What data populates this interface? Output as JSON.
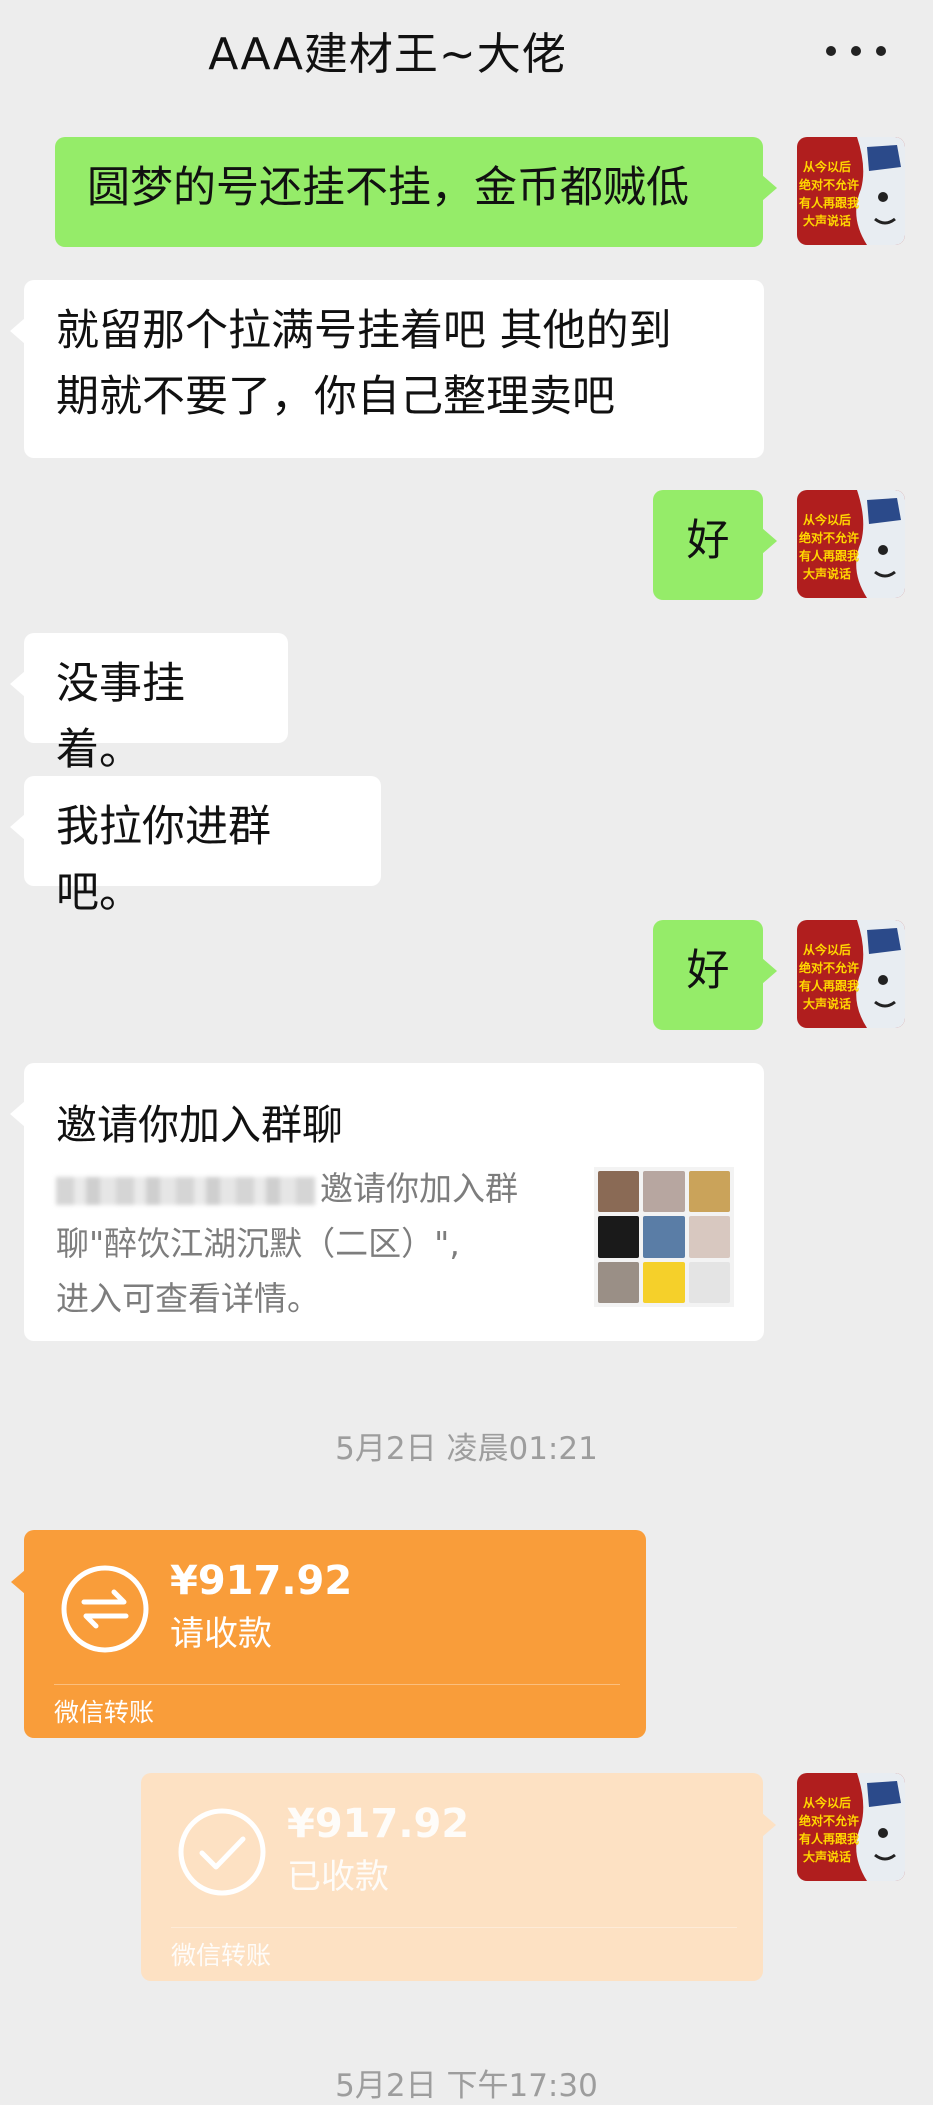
{
  "header": {
    "title": "AAA建材王~大佬",
    "more_icon": "more-dots-icon"
  },
  "avatar": {
    "icon": "cartoon-avatar-icon",
    "text_lines": [
      "从今以后",
      "绝对不允许",
      "有人再跟我",
      "大声说话"
    ]
  },
  "messages": [
    {
      "side": "right",
      "text": "圆梦的号还挂不挂，金币都贼低"
    },
    {
      "side": "left",
      "lines": [
        "就留那个拉满号挂着吧 其他的到",
        "期就不要了，你自己整理卖吧"
      ]
    },
    {
      "side": "right",
      "text": "好"
    },
    {
      "side": "left",
      "text": "没事挂着。"
    },
    {
      "side": "left",
      "text": "我拉你进群吧。"
    },
    {
      "side": "right",
      "text": "好"
    }
  ],
  "invite": {
    "title": "邀请你加入群聊",
    "desc_line1_suffix": "邀请你加入群",
    "desc_line2": "聊\"醉饮江湖沉默（二区）\",",
    "desc_line3": "进入可查看详情。",
    "thumb_icon": "group-avatar-grid-icon"
  },
  "timestamps": {
    "t1": "5月2日 凌晨01:21",
    "t2": "5月2日 下午17:30"
  },
  "transfers": [
    {
      "amount": "¥917.92",
      "status": "请收款",
      "footer": "微信转账",
      "icon": "transfer-arrows-icon"
    },
    {
      "amount": "¥917.92",
      "status": "已收款",
      "footer": "微信转账",
      "icon": "checkmark-icon"
    }
  ]
}
